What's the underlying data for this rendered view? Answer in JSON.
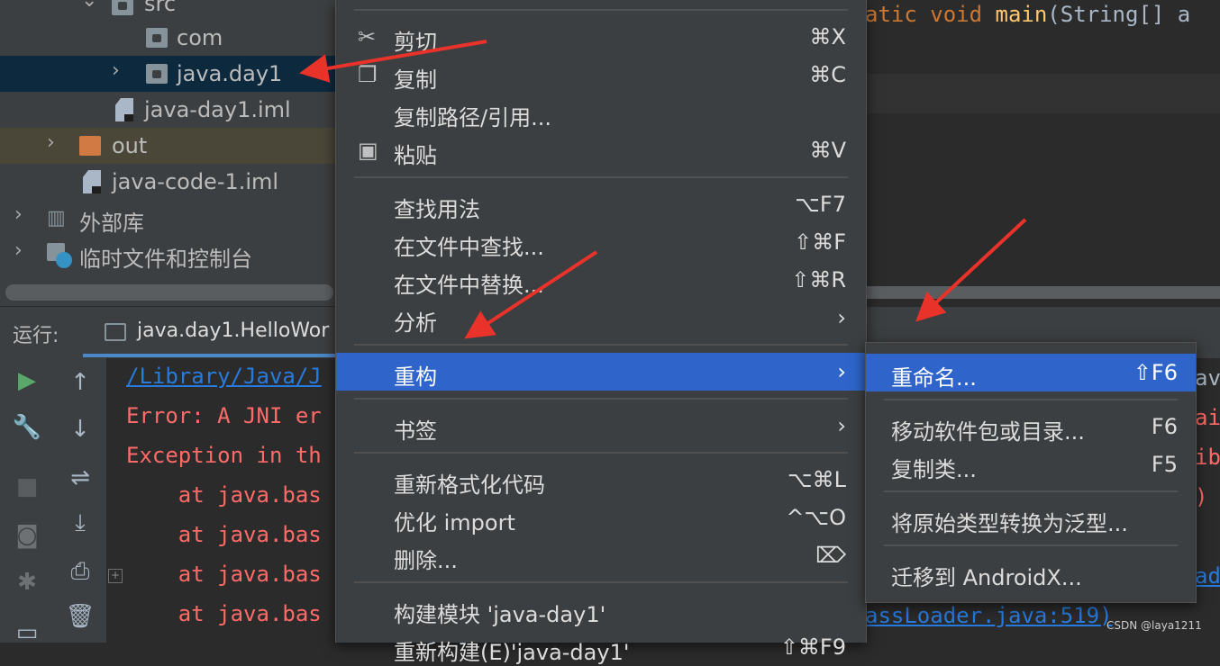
{
  "tree": {
    "items": [
      {
        "label": "src"
      },
      {
        "label": "com"
      },
      {
        "label": "java.day1"
      },
      {
        "label": "java-day1.iml"
      },
      {
        "label": "out"
      },
      {
        "label": "java-code-1.iml"
      },
      {
        "label": "外部库"
      },
      {
        "label": "临时文件和控制台"
      }
    ]
  },
  "editor": {
    "code_tail": "atic void main(String[] a",
    "kw1": "atic void ",
    "fn": "main",
    "rest": "(String[] a"
  },
  "run": {
    "label": "运行:",
    "tab": "java.day1.HelloWor"
  },
  "console": {
    "lines": [
      "/Library/Java/J",
      "Error: A JNI er",
      "Exception in th",
      "    at java.bas",
      "    at java.bas",
      "    at java.bas",
      "    at java.bas"
    ],
    "right_fragments": [
      "av",
      "ai",
      "ib",
      ")",
      "ad"
    ],
    "bottom_right": "assLoader.java:519)"
  },
  "menu": {
    "items": [
      {
        "icon": "scissors-icon",
        "glyph": "✂",
        "label": "剪切",
        "shortcut": "⌘X"
      },
      {
        "icon": "copy-icon",
        "glyph": "❐",
        "label": "复制",
        "shortcut": "⌘C"
      },
      {
        "icon": "",
        "glyph": "",
        "label": "复制路径/引用...",
        "shortcut": ""
      },
      {
        "icon": "paste-icon",
        "glyph": "▣",
        "label": "粘贴",
        "shortcut": "⌘V"
      },
      {
        "icon": "",
        "glyph": "",
        "label": "查找用法",
        "shortcut": "⌥F7"
      },
      {
        "icon": "",
        "glyph": "",
        "label": "在文件中查找...",
        "shortcut": "⇧⌘F"
      },
      {
        "icon": "",
        "glyph": "",
        "label": "在文件中替换...",
        "shortcut": "⇧⌘R"
      },
      {
        "icon": "",
        "glyph": "",
        "label": "分析",
        "shortcut": "›"
      },
      {
        "icon": "",
        "glyph": "",
        "label": "重构",
        "shortcut": "›"
      },
      {
        "icon": "",
        "glyph": "",
        "label": "书签",
        "shortcut": "›"
      },
      {
        "icon": "",
        "glyph": "",
        "label": "重新格式化代码",
        "shortcut": "⌥⌘L"
      },
      {
        "icon": "",
        "glyph": "",
        "label": "优化 import",
        "shortcut": "^⌥O"
      },
      {
        "icon": "",
        "glyph": "",
        "label": "删除...",
        "shortcut": "⌦"
      },
      {
        "icon": "",
        "glyph": "",
        "label": "构建模块 'java-day1'",
        "shortcut": ""
      },
      {
        "icon": "",
        "glyph": "",
        "label": "重新构建(E)'java-day1'",
        "shortcut": "⇧⌘F9"
      }
    ]
  },
  "submenu": {
    "items": [
      {
        "label": "重命名...",
        "shortcut": "⇧F6"
      },
      {
        "label": "移动软件包或目录...",
        "shortcut": "F6"
      },
      {
        "label": "复制类...",
        "shortcut": "F5"
      },
      {
        "label": "将原始类型转换为泛型...",
        "shortcut": ""
      },
      {
        "label": "迁移到 AndroidX...",
        "shortcut": ""
      }
    ]
  },
  "watermark": "CSDN @laya1211",
  "colors": {
    "menu_bg": "#3c3f41",
    "selection": "#2f65ca",
    "tree_selected": "#0d293e",
    "annotation_arrow": "#e8322a",
    "error_text": "#ff6b68"
  }
}
